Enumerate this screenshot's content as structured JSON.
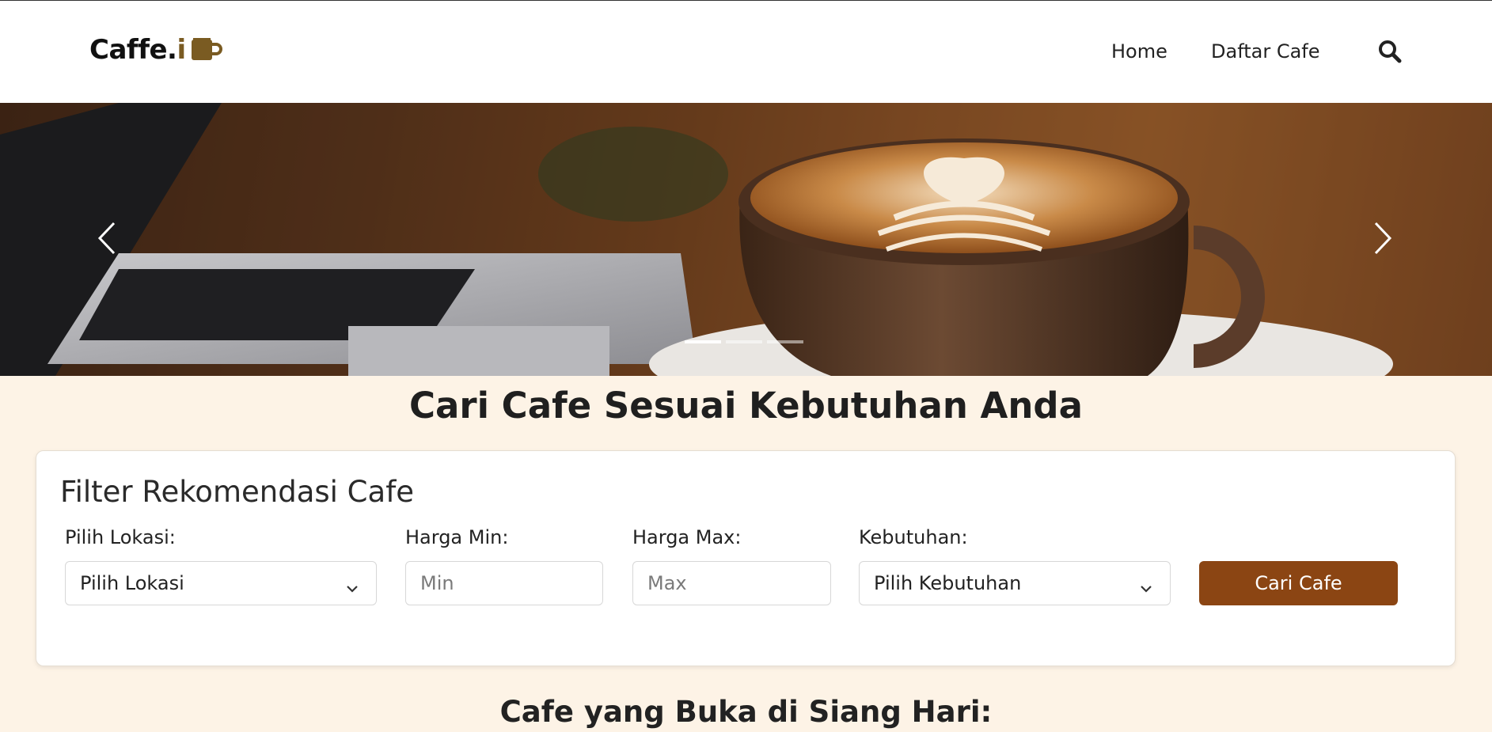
{
  "brand": {
    "text_main": "Caffe.",
    "text_accent": "i",
    "accent_color": "#7a5b22",
    "icon": "coffee-mug-icon"
  },
  "nav": {
    "items": [
      {
        "label": "Home"
      },
      {
        "label": "Daftar Cafe"
      }
    ],
    "search_icon": "search-icon"
  },
  "hero": {
    "prev_icon": "chevron-left-icon",
    "next_icon": "chevron-right-icon",
    "slides_count": 3,
    "active_slide": 1
  },
  "main_title": "Cari Cafe Sesuai Kebutuhan Anda",
  "filter": {
    "title": "Filter Rekomendasi Cafe",
    "lokasi": {
      "label": "Pilih Lokasi:",
      "value": "Pilih Lokasi"
    },
    "harga_min": {
      "label": "Harga Min:",
      "placeholder": "Min"
    },
    "harga_max": {
      "label": "Harga Max:",
      "placeholder": "Max"
    },
    "kebutuhan": {
      "label": "Kebutuhan:",
      "value": "Pilih Kebutuhan"
    },
    "submit_label": "Cari Cafe",
    "submit_color": "#8b4513"
  },
  "section_title": "Cafe yang Buka di Siang Hari:"
}
